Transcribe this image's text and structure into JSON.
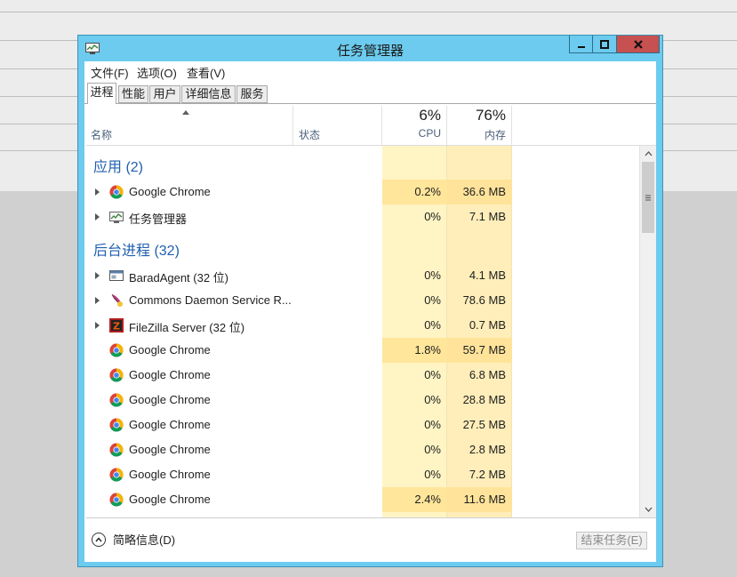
{
  "window": {
    "title": "任务管理器",
    "accent": "#6ccbee",
    "close_color": "#c75050"
  },
  "menu": {
    "file": "文件(F)",
    "options": "选项(O)",
    "view": "查看(V)"
  },
  "tabs": [
    {
      "label": "进程",
      "active": true
    },
    {
      "label": "性能",
      "active": false
    },
    {
      "label": "用户",
      "active": false
    },
    {
      "label": "详细信息",
      "active": false
    },
    {
      "label": "服务",
      "active": false
    }
  ],
  "columns": {
    "name": "名称",
    "status": "状态",
    "cpu_label": "CPU",
    "cpu_total": "6%",
    "mem_label": "内存",
    "mem_total": "76%"
  },
  "groups": {
    "apps": {
      "title": "应用 (2)",
      "rows": [
        {
          "name": "Google Chrome",
          "icon": "chrome-icon",
          "cpu": "0.2%",
          "mem": "36.6 MB",
          "expandable": true,
          "hi": true
        },
        {
          "name": "任务管理器",
          "icon": "task-manager-icon",
          "cpu": "0%",
          "mem": "7.1 MB",
          "expandable": true,
          "hi": false
        }
      ]
    },
    "background": {
      "title": "后台进程 (32)",
      "rows": [
        {
          "name": "BaradAgent (32 位)",
          "icon": "app-window-icon",
          "cpu": "0%",
          "mem": "4.1 MB",
          "expandable": true,
          "hi": false
        },
        {
          "name": "Commons Daemon Service R...",
          "icon": "feather-icon",
          "cpu": "0%",
          "mem": "78.6 MB",
          "expandable": true,
          "hi": false
        },
        {
          "name": "FileZilla Server (32 位)",
          "icon": "filezilla-icon",
          "cpu": "0%",
          "mem": "0.7 MB",
          "expandable": true,
          "hi": false
        },
        {
          "name": "Google Chrome",
          "icon": "chrome-icon",
          "cpu": "1.8%",
          "mem": "59.7 MB",
          "expandable": false,
          "hi": true
        },
        {
          "name": "Google Chrome",
          "icon": "chrome-icon",
          "cpu": "0%",
          "mem": "6.8 MB",
          "expandable": false,
          "hi": false
        },
        {
          "name": "Google Chrome",
          "icon": "chrome-icon",
          "cpu": "0%",
          "mem": "28.8 MB",
          "expandable": false,
          "hi": false
        },
        {
          "name": "Google Chrome",
          "icon": "chrome-icon",
          "cpu": "0%",
          "mem": "27.5 MB",
          "expandable": false,
          "hi": false
        },
        {
          "name": "Google Chrome",
          "icon": "chrome-icon",
          "cpu": "0%",
          "mem": "2.8 MB",
          "expandable": false,
          "hi": false
        },
        {
          "name": "Google Chrome",
          "icon": "chrome-icon",
          "cpu": "0%",
          "mem": "7.2 MB",
          "expandable": false,
          "hi": false
        },
        {
          "name": "Google Chrome",
          "icon": "chrome-icon",
          "cpu": "2.4%",
          "mem": "11.6 MB",
          "expandable": false,
          "hi": true
        }
      ]
    }
  },
  "footer": {
    "fewer_details": "简略信息(D)",
    "end_task": "结束任务(E)"
  }
}
